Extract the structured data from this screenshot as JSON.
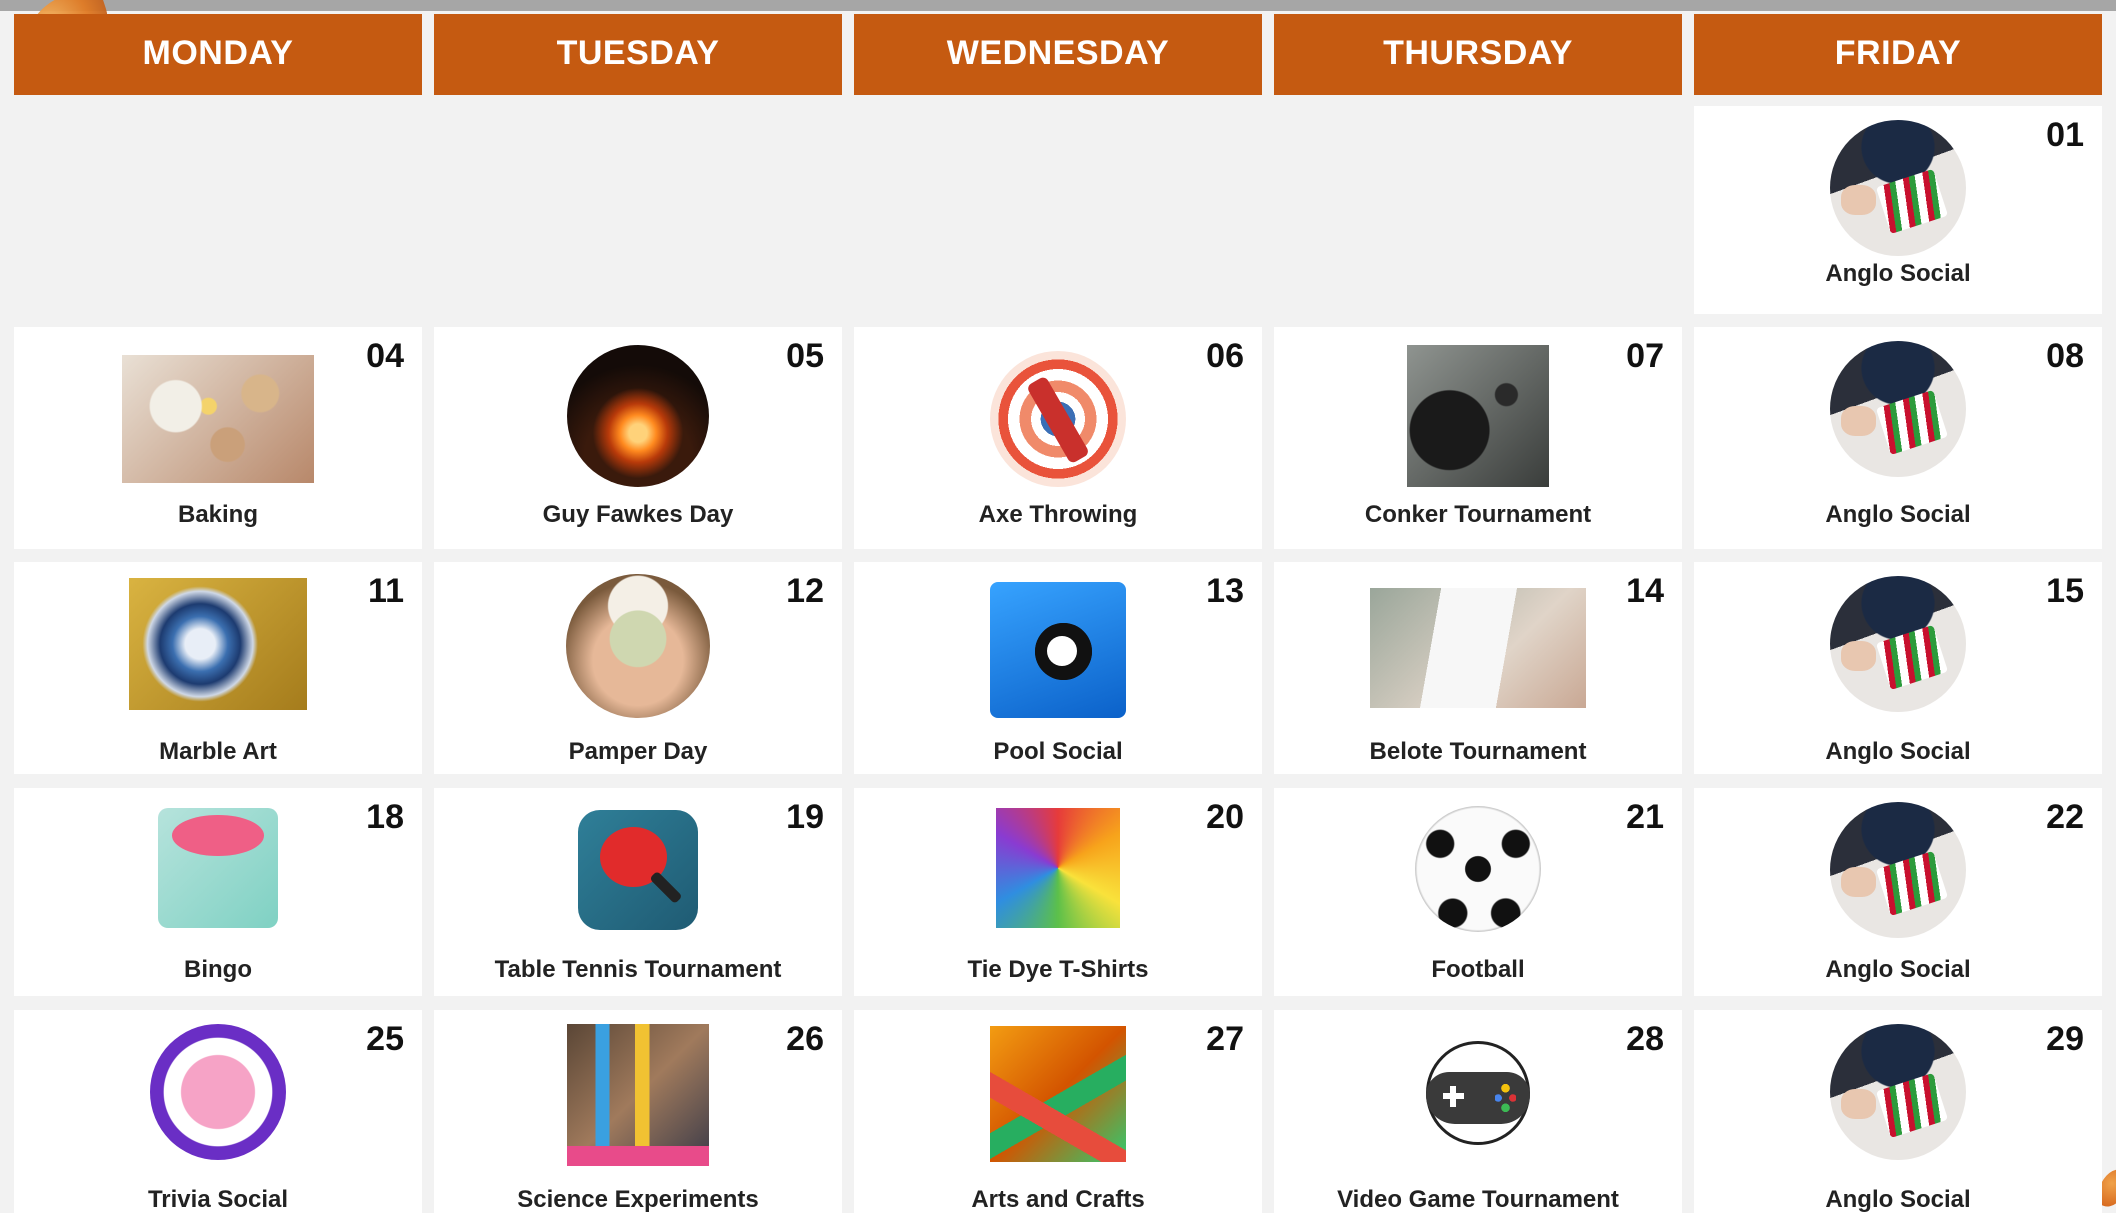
{
  "headers": [
    "MONDAY",
    "TUESDAY",
    "WEDNESDAY",
    "THURSDAY",
    "FRIDAY"
  ],
  "rows": [
    [
      null,
      null,
      null,
      null,
      {
        "day": "01",
        "label": "Anglo Social",
        "image": "playing-cards-photo"
      }
    ],
    [
      {
        "day": "04",
        "label": "Baking",
        "image": "baking-ingredients-photo"
      },
      {
        "day": "05",
        "label": "Guy Fawkes Day",
        "image": "bonfire-photo"
      },
      {
        "day": "06",
        "label": "Axe Throwing",
        "image": "axe-target-icon"
      },
      {
        "day": "07",
        "label": "Conker Tournament",
        "image": "conker-photo"
      },
      {
        "day": "08",
        "label": "Anglo Social",
        "image": "playing-cards-photo"
      }
    ],
    [
      {
        "day": "11",
        "label": "Marble Art",
        "image": "marble-art-photo"
      },
      {
        "day": "12",
        "label": "Pamper Day",
        "image": "face-mask-photo"
      },
      {
        "day": "13",
        "label": "Pool Social",
        "image": "pool-balls-icon"
      },
      {
        "day": "14",
        "label": "Belote Tournament",
        "image": "card-hand-photo"
      },
      {
        "day": "15",
        "label": "Anglo Social",
        "image": "playing-cards-photo"
      }
    ],
    [
      {
        "day": "18",
        "label": "Bingo",
        "image": "bingo-card-icon"
      },
      {
        "day": "19",
        "label": "Table Tennis Tournament",
        "image": "ping-pong-icon"
      },
      {
        "day": "20",
        "label": "Tie Dye T-Shirts",
        "image": "tie-dye-shirt-photo"
      },
      {
        "day": "21",
        "label": "Football",
        "image": "football-icon"
      },
      {
        "day": "22",
        "label": "Anglo Social",
        "image": "playing-cards-photo"
      }
    ],
    [
      {
        "day": "25",
        "label": "Trivia Social",
        "image": "brain-mascot-icon"
      },
      {
        "day": "26",
        "label": "Science Experiments",
        "image": "science-lab-photo"
      },
      {
        "day": "27",
        "label": "Arts and Crafts",
        "image": "paper-craft-photo"
      },
      {
        "day": "28",
        "label": "Video Game Tournament",
        "image": "game-controller-icon"
      },
      {
        "day": "29",
        "label": "Anglo Social",
        "image": "playing-cards-photo"
      }
    ]
  ],
  "colors": {
    "header": "#c55a11",
    "page": "#f2f2f2",
    "cell": "#ffffff"
  }
}
